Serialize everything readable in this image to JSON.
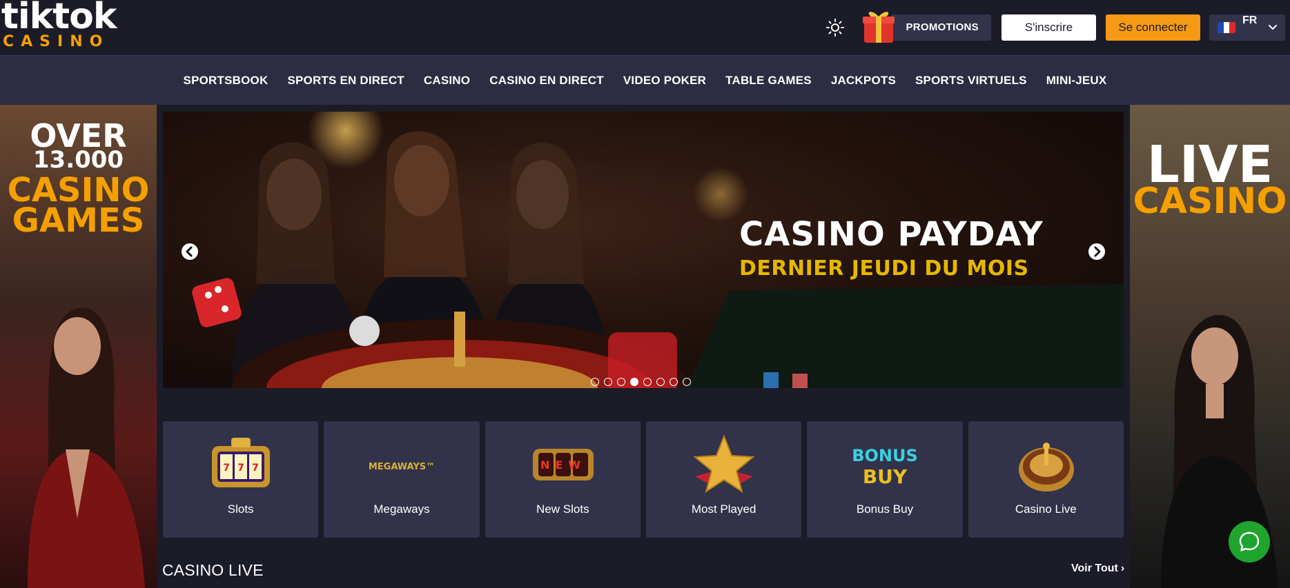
{
  "brand": {
    "logo_line1": "tiktok",
    "logo_line2": "CASINO"
  },
  "header": {
    "promotions_label": "PROMOTIONS",
    "signup_label": "S'inscrire",
    "login_label": "Se connecter",
    "language_code": "FR"
  },
  "nav": {
    "items": [
      {
        "label": "SPORTSBOOK"
      },
      {
        "label": "SPORTS EN DIRECT"
      },
      {
        "label": "CASINO"
      },
      {
        "label": "CASINO EN DIRECT"
      },
      {
        "label": "VIDEO POKER"
      },
      {
        "label": "TABLE GAMES"
      },
      {
        "label": "JACKPOTS"
      },
      {
        "label": "SPORTS VIRTUELS"
      },
      {
        "label": "MINI-JEUX"
      }
    ]
  },
  "left_banner": {
    "line1": "OVER",
    "line2": "13.000",
    "line3": "CASINO",
    "line4": "GAMES"
  },
  "right_banner": {
    "line1": "LIVE",
    "line2": "CASINO"
  },
  "hero": {
    "title": "CASINO PAYDAY",
    "subtitle": "DERNIER JEUDI DU MOIS",
    "slide_count": 8,
    "active_slide": 4
  },
  "categories": [
    {
      "label": "Slots",
      "icon": "slot-machine-icon"
    },
    {
      "label": "Megaways",
      "icon": "megaways-logo-icon",
      "logo_text": "MEGAWAYS™"
    },
    {
      "label": "New Slots",
      "icon": "new-slots-reels-icon",
      "logo_text": "NEW"
    },
    {
      "label": "Most Played",
      "icon": "star-ribbon-icon"
    },
    {
      "label": "Bonus Buy",
      "icon": "bonus-buy-icon",
      "logo_line1": "BONUS",
      "logo_line2": "BUY"
    },
    {
      "label": "Casino Live",
      "icon": "roulette-wheel-icon"
    }
  ],
  "section": {
    "title": "CASINO LIVE",
    "see_all": "Voir Tout"
  },
  "colors": {
    "background": "#1b1c28",
    "nav_bg": "#2c2d42",
    "card_bg": "#32334a",
    "accent_orange": "#f59a12",
    "accent_gold": "#e5b800",
    "chat_green": "#1fa52e"
  }
}
